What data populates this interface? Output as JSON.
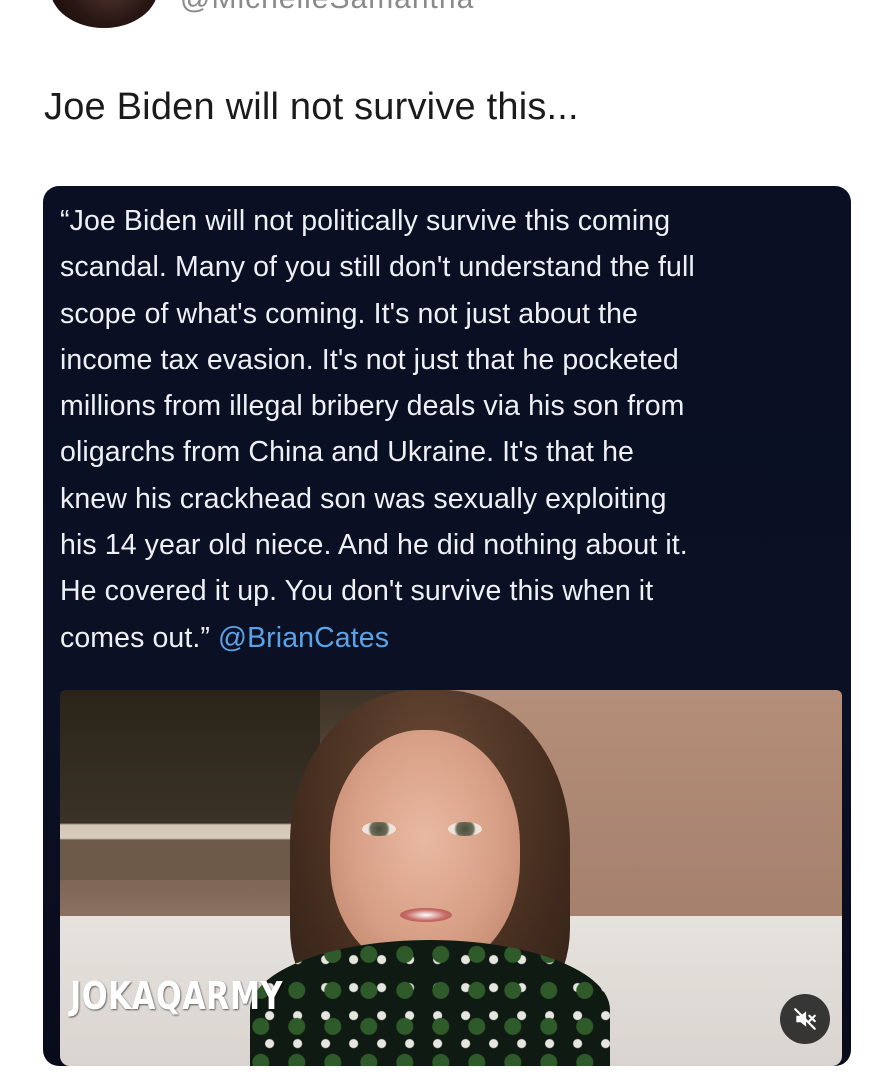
{
  "post": {
    "handle": "@MichelleSamantha",
    "text": "Joe Biden will not survive this..."
  },
  "embed": {
    "quote": "“Joe Biden will not politically survive this coming\nscandal. Many of you still don't understand the full\nscope of what's coming. It's not just about the\nincome tax evasion. It's not just that he pocketed\nmillions from illegal bribery deals via his son from\noligarchs from China and Ukraine. It's that he\nknew his crackhead son was sexually exploiting\nhis 14 year old niece. And he did nothing about it.\nHe covered it up. You don't survive this when it\ncomes out.”",
    "mention": "@BrianCates",
    "video": {
      "watermark": "JOKAQARMY",
      "mute_icon": "speaker-muted-icon"
    }
  },
  "colors": {
    "card_bg": "#0a0f24",
    "mention": "#5aa3e8",
    "text": "#eef0f4"
  }
}
